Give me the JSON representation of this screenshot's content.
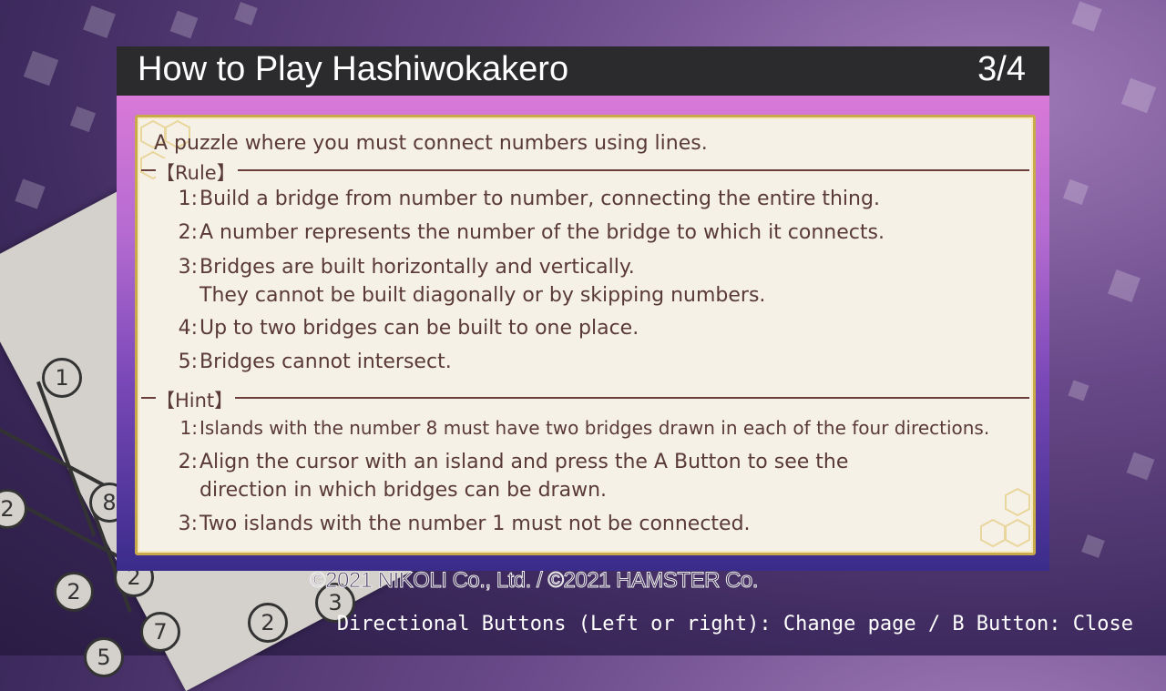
{
  "window": {
    "title": "How to Play Hashiwokakero",
    "page_indicator": "3/4"
  },
  "intro": "A puzzle where you must connect numbers using lines.",
  "rule": {
    "label": "【Rule】",
    "items": [
      {
        "num": "1:",
        "text": "Build a bridge from number to number, connecting the entire thing."
      },
      {
        "num": "2:",
        "text": "A number represents the number of the bridge to which it connects."
      },
      {
        "num": "3:",
        "text": "Bridges are built horizontally and vertically.\nThey cannot be built diagonally or by skipping numbers."
      },
      {
        "num": "4:",
        "text": "Up to two bridges can be built to one place."
      },
      {
        "num": "5:",
        "text": "Bridges cannot intersect."
      }
    ]
  },
  "hint": {
    "label": "【Hint】",
    "items": [
      {
        "num": "1:",
        "text": "Islands with the number 8 must have two bridges drawn in each of the four directions."
      },
      {
        "num": "2:",
        "text": "Align the cursor with an island and press the A Button to see the\ndirection in which bridges can be drawn."
      },
      {
        "num": "3:",
        "text": "Two islands with the number 1 must not be connected."
      }
    ]
  },
  "background_puzzle": {
    "numbers": [
      "1",
      "2",
      "8",
      "2",
      "2",
      "7",
      "2",
      "3",
      "5"
    ]
  },
  "copyright": "©2021 NIKOLI Co., Ltd. / ©2021 HAMSTER Co.",
  "controls_hint": "Directional Buttons (Left or right): Change page / B Button: Close",
  "colors": {
    "title_bar": "#2b2b2e",
    "content_bg": "#f5f1e6",
    "text": "#5a3a36",
    "frame_gold": "#c9aa4a"
  }
}
